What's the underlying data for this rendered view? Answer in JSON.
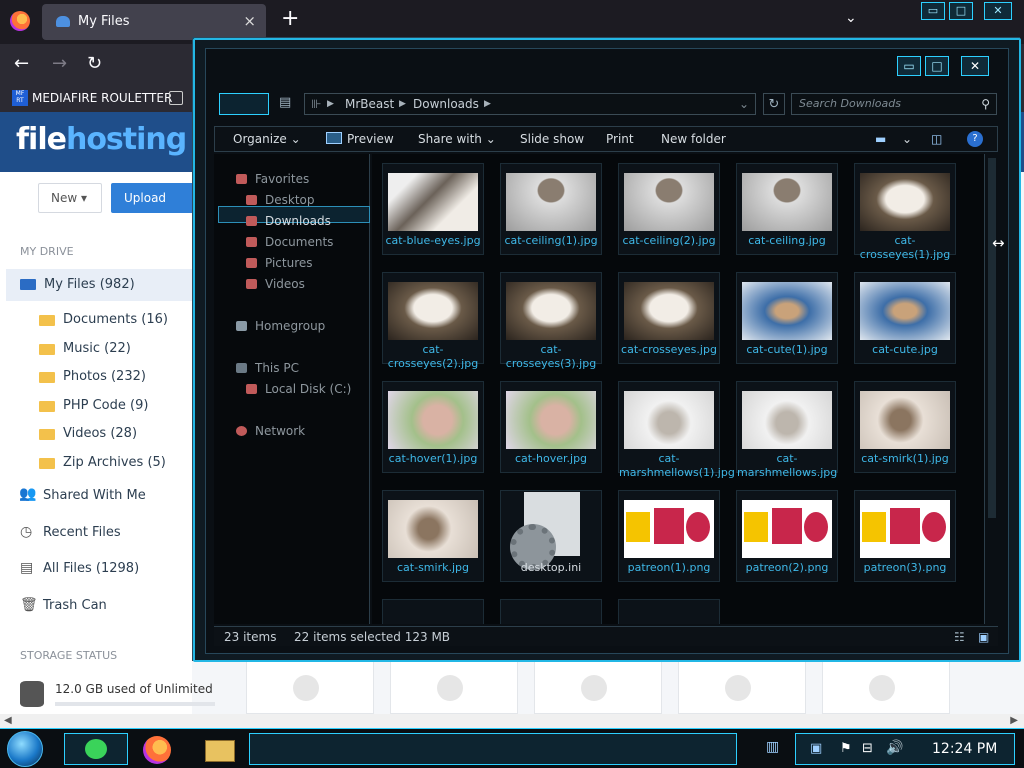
{
  "browser": {
    "tab_title": "My Files",
    "tab_close": "×",
    "new_tab": "+",
    "tab_list": "⌄",
    "bookmark": "MEDIAFIRE ROULETTER",
    "bookmark_icon": "MF RT"
  },
  "site": {
    "brand_a": "file",
    "brand_b": "hosting",
    "btn_new": "New",
    "btn_upload": "Upload",
    "my_drive": "MY DRIVE",
    "my_files": "My Files (982)",
    "folders": [
      "Documents (16)",
      "Music (22)",
      "Photos (232)",
      "PHP Code (9)",
      "Videos (28)",
      "Zip Archives (5)"
    ],
    "shared": "Shared With Me",
    "recent": "Recent Files",
    "all_files": "All Files (1298)",
    "trash": "Trash Can",
    "storage_status": "STORAGE STATUS",
    "usage": "12.0 GB used of Unlimited"
  },
  "explorer": {
    "address": [
      "MrBeast",
      "Downloads"
    ],
    "search_placeholder": "Search Downloads",
    "commands": {
      "organize": "Organize",
      "preview": "Preview",
      "share_with": "Share with",
      "slide_show": "Slide show",
      "print": "Print",
      "new_folder": "New folder"
    },
    "nav": {
      "favorites": "Favorites",
      "desktop": "Desktop",
      "downloads": "Downloads",
      "documents": "Documents",
      "pictures": "Pictures",
      "videos": "Videos",
      "homegroup": "Homegroup",
      "this_pc": "This PC",
      "local_disk": "Local Disk (C:)",
      "network": "Network"
    },
    "files": [
      "cat-blue-eyes.jpg",
      "cat-ceiling(1).jpg",
      "cat-ceiling(2).jpg",
      "cat-ceiling.jpg",
      "cat-crosseyes(1).jpg",
      "cat-crosseyes(2).jpg",
      "cat-crosseyes(3).jpg",
      "cat-crosseyes.jpg",
      "cat-cute(1).jpg",
      "cat-cute.jpg",
      "cat-hover(1).jpg",
      "cat-hover.jpg",
      "cat-marshmellows(1).jpg",
      "cat-marshmellows.jpg",
      "cat-smirk(1).jpg",
      "cat-smirk.jpg",
      "desktop.ini",
      "patreon(1).png",
      "patreon(2).png",
      "patreon(3).png"
    ],
    "status_items": "23 items",
    "status_selected": "22 items selected  123 MB"
  },
  "taskbar": {
    "clock": "12:24 PM"
  },
  "colors": {
    "accent": "#23b7e5",
    "brand_bar": "#1f4e8a",
    "upload_button": "#2f7fd8",
    "file_label": "#3fb8e8"
  }
}
